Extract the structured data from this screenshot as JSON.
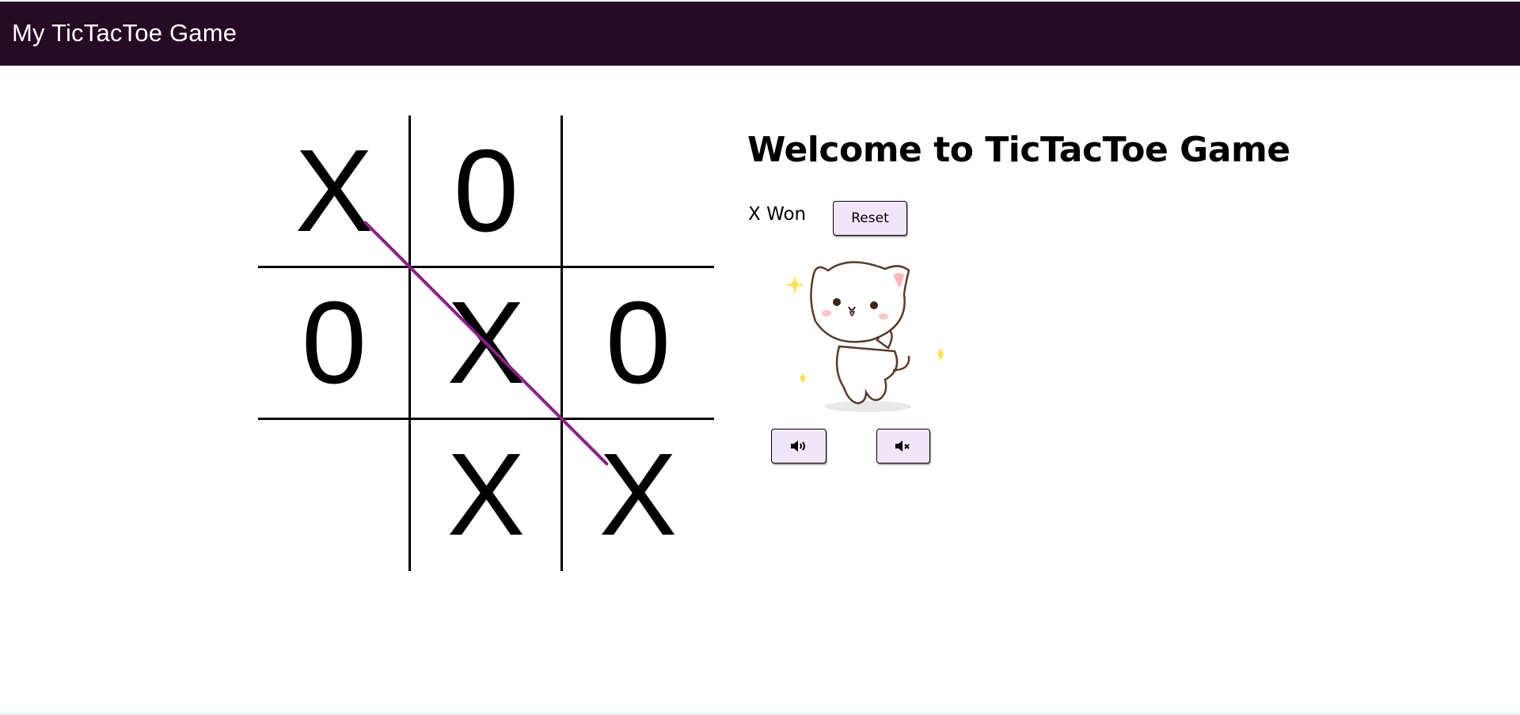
{
  "header": {
    "title": "My TicTacToe Game"
  },
  "game": {
    "heading": "Welcome to TicTacToe Game",
    "status": "X Won",
    "reset_label": "Reset",
    "board": [
      "X",
      "0",
      "",
      "0",
      "X",
      "0",
      "",
      "X",
      "X"
    ],
    "winning_cells": [
      0,
      4,
      8
    ],
    "win_line_color": "#8e1d8e"
  },
  "controls": {
    "sound_on_icon": "speaker-volume-icon",
    "sound_off_icon": "speaker-mute-icon"
  },
  "colors": {
    "header_bg": "#270a24",
    "button_bg": "#f1e6f8"
  }
}
